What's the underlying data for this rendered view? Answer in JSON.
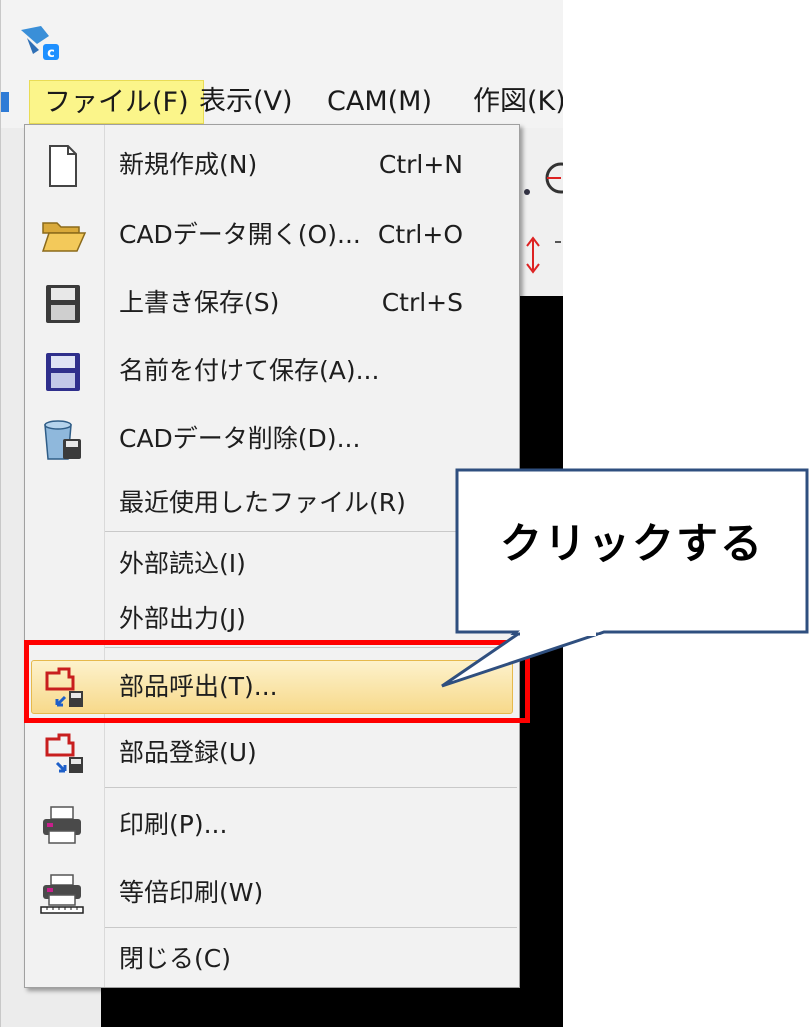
{
  "menubar": {
    "items": [
      {
        "label": "ファイル(F)",
        "active": true
      },
      {
        "label": "表示(V)"
      },
      {
        "label": "CAM(M)"
      },
      {
        "label": "作図(K)"
      }
    ]
  },
  "file_menu": {
    "items": [
      {
        "label": "新規作成(N)",
        "shortcut": "Ctrl+N",
        "icon": "new-document-icon"
      },
      {
        "label": "CADデータ開く(O)...",
        "shortcut": "Ctrl+O",
        "icon": "open-folder-icon"
      },
      {
        "label": "上書き保存(S)",
        "shortcut": "Ctrl+S",
        "icon": "save-icon"
      },
      {
        "label": "名前を付けて保存(A)...",
        "icon": "save-as-icon"
      },
      {
        "label": "CADデータ削除(D)...",
        "icon": "delete-data-icon"
      },
      {
        "label": "最近使用したファイル(R)"
      },
      {
        "label": "外部読込(I)"
      },
      {
        "label": "外部出力(J)"
      },
      {
        "label": "部品呼出(T)...",
        "icon": "part-call-icon",
        "highlighted": true
      },
      {
        "label": "部品登録(U)",
        "icon": "part-register-icon"
      },
      {
        "label": "印刷(P)...",
        "icon": "print-icon"
      },
      {
        "label": "等倍印刷(W)",
        "icon": "actual-size-print-icon"
      },
      {
        "label": "閉じる(C)"
      }
    ]
  },
  "annotation": {
    "callout_text": "クリックする",
    "highlight_color": "#ff0000"
  }
}
